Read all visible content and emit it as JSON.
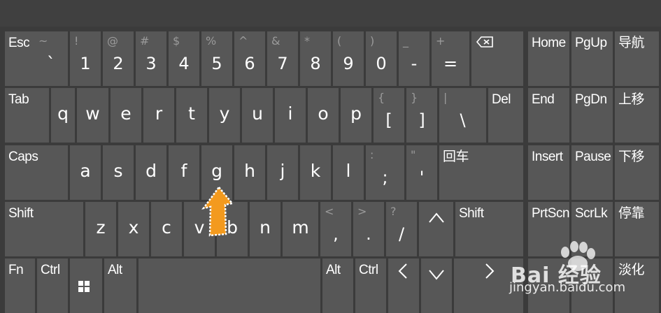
{
  "keyboard": {
    "row1": [
      {
        "label": "Esc"
      },
      {
        "shift": "~",
        "char": "`"
      },
      {
        "shift": "!",
        "char": "1"
      },
      {
        "shift": "@",
        "char": "2"
      },
      {
        "shift": "#",
        "char": "3"
      },
      {
        "shift": "$",
        "char": "4"
      },
      {
        "shift": "%",
        "char": "5"
      },
      {
        "shift": "^",
        "char": "6"
      },
      {
        "shift": "&",
        "char": "7"
      },
      {
        "shift": "*",
        "char": "8"
      },
      {
        "shift": "(",
        "char": "9"
      },
      {
        "shift": ")",
        "char": "0"
      },
      {
        "shift": "_",
        "char": "-"
      },
      {
        "shift": "+",
        "char": "="
      },
      {
        "icon": "backspace-icon"
      }
    ],
    "row2": [
      {
        "label": "Tab"
      },
      {
        "char": "q"
      },
      {
        "char": "w"
      },
      {
        "char": "e"
      },
      {
        "char": "r"
      },
      {
        "char": "t"
      },
      {
        "char": "y"
      },
      {
        "char": "u"
      },
      {
        "char": "i"
      },
      {
        "char": "o"
      },
      {
        "char": "p"
      },
      {
        "shift": "{",
        "char": "["
      },
      {
        "shift": "}",
        "char": "]"
      },
      {
        "shift": "|",
        "char": "\\"
      },
      {
        "label": "Del"
      }
    ],
    "row3": [
      {
        "label": "Caps"
      },
      {
        "char": "a"
      },
      {
        "char": "s"
      },
      {
        "char": "d"
      },
      {
        "char": "f"
      },
      {
        "char": "g"
      },
      {
        "char": "h"
      },
      {
        "char": "j"
      },
      {
        "char": "k"
      },
      {
        "char": "l"
      },
      {
        "shift": ":",
        "char": ";"
      },
      {
        "shift": "\"",
        "char": "'"
      },
      {
        "label": "回车"
      }
    ],
    "row4": [
      {
        "label": "Shift"
      },
      {
        "char": "z"
      },
      {
        "char": "x"
      },
      {
        "char": "c"
      },
      {
        "char": "v"
      },
      {
        "char": "b"
      },
      {
        "char": "n"
      },
      {
        "char": "m"
      },
      {
        "shift": "<",
        "char": ","
      },
      {
        "shift": ">",
        "char": "."
      },
      {
        "shift": "?",
        "char": "/"
      },
      {
        "symbol": "^"
      },
      {
        "label": "Shift"
      }
    ],
    "row5": [
      {
        "label": "Fn"
      },
      {
        "label": "Ctrl"
      },
      {
        "icon": "windows-logo-icon"
      },
      {
        "label": "Alt"
      },
      {
        "label": ""
      },
      {
        "label": "Alt"
      },
      {
        "label": "Ctrl"
      },
      {
        "symbol": "<"
      },
      {
        "symbol": "v"
      },
      {
        "symbol": ">"
      }
    ],
    "nav": [
      [
        "Home",
        "PgUp",
        "导航"
      ],
      [
        "End",
        "PgDn",
        "上移"
      ],
      [
        "Insert",
        "Pause",
        "下移"
      ],
      [
        "PrtScn",
        "ScrLk",
        "停靠"
      ],
      [
        "",
        "",
        "淡化"
      ]
    ]
  },
  "watermark": {
    "brand": "Bai  经验",
    "url": "jingyan.baidu.com"
  },
  "colors": {
    "background": "#3b3b3b",
    "key": "#575757",
    "cursor": "#f39a1e"
  }
}
